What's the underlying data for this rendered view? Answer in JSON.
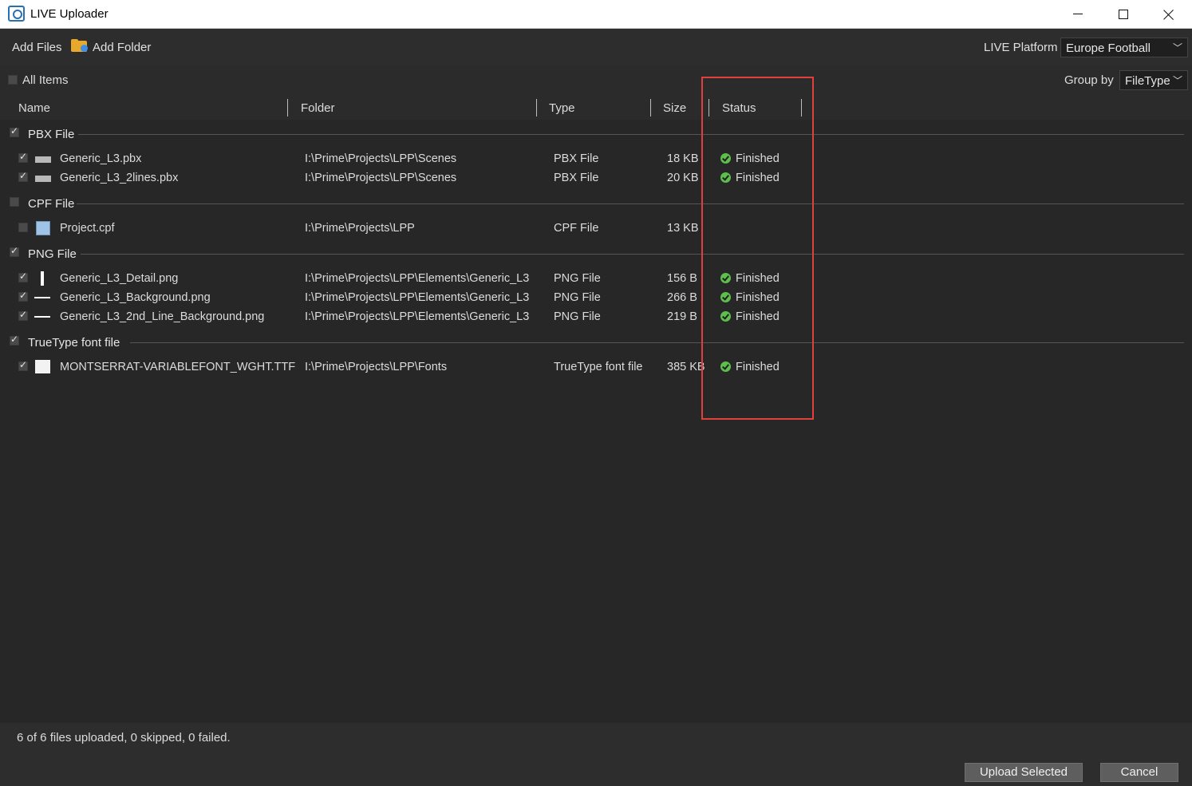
{
  "window": {
    "title": "LIVE Uploader"
  },
  "toolbar": {
    "add_files": "Add Files",
    "add_folder": "Add Folder",
    "platform_label": "LIVE Platform",
    "platform_value": "Europe Football"
  },
  "filter": {
    "all_items": "All Items",
    "group_by_label": "Group by",
    "group_by_value": "FileType"
  },
  "columns": {
    "name": "Name",
    "folder": "Folder",
    "type": "Type",
    "size": "Size",
    "status": "Status"
  },
  "groups": [
    {
      "label": "PBX File",
      "checked": true,
      "items": [
        {
          "name": "Generic_L3.pbx",
          "folder": "I:\\Prime\\Projects\\LPP\\Scenes",
          "type": "PBX File",
          "size": "18 KB",
          "status": "Finished",
          "icon": "pbx-file-icon",
          "checked": true
        },
        {
          "name": "Generic_L3_2lines.pbx",
          "folder": "I:\\Prime\\Projects\\LPP\\Scenes",
          "type": "PBX File",
          "size": "20 KB",
          "status": "Finished",
          "icon": "pbx-file-icon",
          "checked": true
        }
      ]
    },
    {
      "label": "CPF File",
      "checked": false,
      "items": [
        {
          "name": "Project.cpf",
          "folder": "I:\\Prime\\Projects\\LPP",
          "type": "CPF File",
          "size": "13 KB",
          "status": "",
          "icon": "cpf-file-icon",
          "checked": false
        }
      ]
    },
    {
      "label": "PNG File",
      "checked": true,
      "items": [
        {
          "name": "Generic_L3_Detail.png",
          "folder": "I:\\Prime\\Projects\\LPP\\Elements\\Generic_L3",
          "type": "PNG File",
          "size": "156 B",
          "status": "Finished",
          "icon": "png-thumbnail-vertical-icon",
          "checked": true
        },
        {
          "name": "Generic_L3_Background.png",
          "folder": "I:\\Prime\\Projects\\LPP\\Elements\\Generic_L3",
          "type": "PNG File",
          "size": "266 B",
          "status": "Finished",
          "icon": "png-thumbnail-horizontal-icon",
          "checked": true
        },
        {
          "name": "Generic_L3_2nd_Line_Background.png",
          "folder": "I:\\Prime\\Projects\\LPP\\Elements\\Generic_L3",
          "type": "PNG File",
          "size": "219 B",
          "status": "Finished",
          "icon": "png-thumbnail-horizontal-icon",
          "checked": true
        }
      ]
    },
    {
      "label": "TrueType font file",
      "checked": true,
      "items": [
        {
          "name": "MONTSERRAT-VARIABLEFONT_WGHT.TTF",
          "folder": "I:\\Prime\\Projects\\LPP\\Fonts",
          "type": "TrueType font file",
          "size": "385 KB",
          "status": "Finished",
          "icon": "font-file-icon",
          "checked": true
        }
      ]
    }
  ],
  "footer": {
    "summary": "6 of 6 files uploaded, 0 skipped, 0 failed.",
    "upload_selected": "Upload Selected",
    "cancel": "Cancel"
  },
  "colors": {
    "background": "#272727",
    "accent_highlight": "#e0413c",
    "status_ok": "#5cc04a",
    "folder_icon": "#e8a92b"
  }
}
